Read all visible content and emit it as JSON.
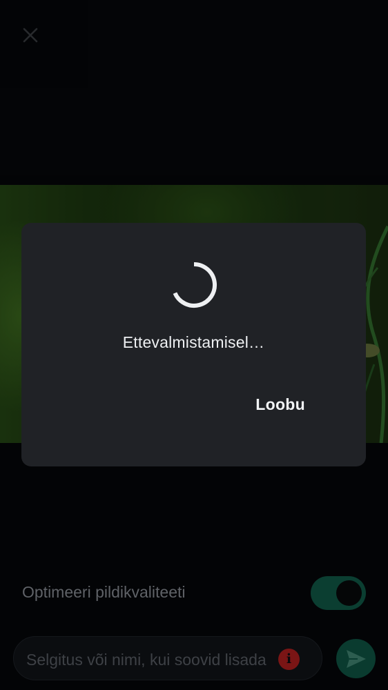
{
  "header": {
    "close_icon": "close-icon"
  },
  "dialog": {
    "message": "Ettevalmistamisel…",
    "cancel_label": "Loobu",
    "spinner_icon": "progress-spinner-icon"
  },
  "options": {
    "optimize_label": "Optimeeri pildikvaliteeti",
    "optimize_enabled": true
  },
  "composer": {
    "caption_placeholder": "Selgitus või nimi, kui soovid lisada",
    "info_badge": "i",
    "send_icon": "send-icon"
  },
  "colors": {
    "background": "#07090c",
    "dialog": "#202226",
    "accent": "#0b3e31",
    "error": "#7a1515"
  }
}
